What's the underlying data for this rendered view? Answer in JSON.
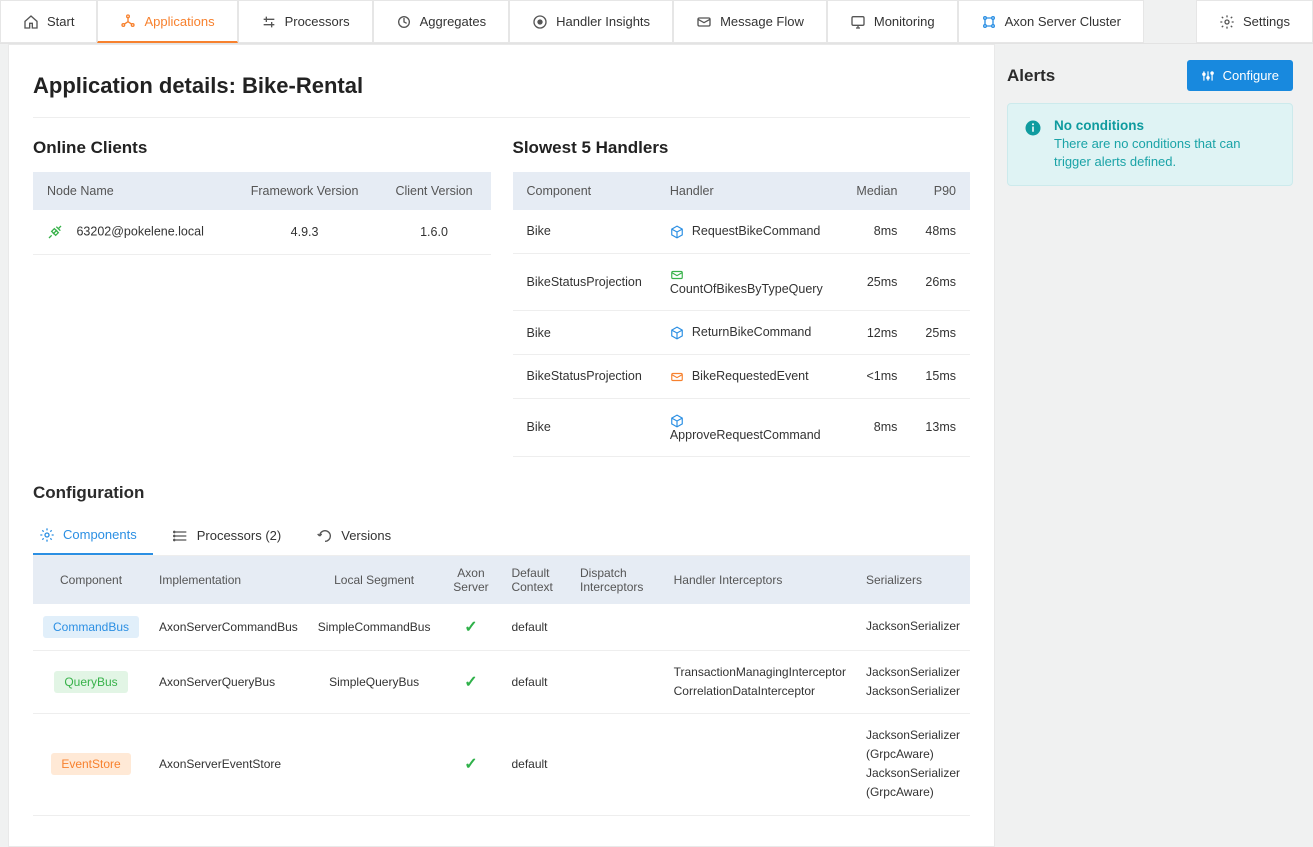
{
  "nav": {
    "start": "Start",
    "applications": "Applications",
    "processors": "Processors",
    "aggregates": "Aggregates",
    "handler_insights": "Handler Insights",
    "message_flow": "Message Flow",
    "monitoring": "Monitoring",
    "axon_server_cluster": "Axon Server Cluster",
    "settings": "Settings"
  },
  "page_title": "Application details: Bike-Rental",
  "online_clients": {
    "title": "Online Clients",
    "headers": {
      "node": "Node Name",
      "fw": "Framework Version",
      "client": "Client Version"
    },
    "rows": [
      {
        "node": "63202@pokelene.local",
        "fw": "4.9.3",
        "client": "1.6.0"
      }
    ]
  },
  "slowest": {
    "title": "Slowest 5 Handlers",
    "headers": {
      "component": "Component",
      "handler": "Handler",
      "median": "Median",
      "p90": "P90"
    },
    "rows": [
      {
        "component": "Bike",
        "icon": "cube-blue",
        "handler": "RequestBikeCommand",
        "median": "8ms",
        "p90": "48ms"
      },
      {
        "component": "BikeStatusProjection",
        "icon": "mail-green",
        "handler": "CountOfBikesByTypeQuery",
        "median": "25ms",
        "p90": "26ms"
      },
      {
        "component": "Bike",
        "icon": "cube-blue",
        "handler": "ReturnBikeCommand",
        "median": "12ms",
        "p90": "25ms"
      },
      {
        "component": "BikeStatusProjection",
        "icon": "mail-orange",
        "handler": "BikeRequestedEvent",
        "median": "<1ms",
        "p90": "15ms"
      },
      {
        "component": "Bike",
        "icon": "cube-blue",
        "handler": "ApproveRequestCommand",
        "median": "8ms",
        "p90": "13ms"
      }
    ]
  },
  "configuration": {
    "title": "Configuration",
    "tabs": {
      "components": "Components",
      "processors": "Processors (2)",
      "versions": "Versions"
    },
    "headers": {
      "component": "Component",
      "implementation": "Implementation",
      "local_segment": "Local Segment",
      "axon_server": "Axon Server",
      "default_context": "Default Context",
      "dispatch_interceptors": "Dispatch Interceptors",
      "handler_interceptors": "Handler Interceptors",
      "serializers": "Serializers"
    },
    "rows": [
      {
        "badge": "CommandBus",
        "badge_class": "cmd",
        "implementation": "AxonServerCommandBus",
        "local_segment": "SimpleCommandBus",
        "axon_server": "check",
        "default_context": "default",
        "dispatch_interceptors": "",
        "handler_interceptors": "",
        "serializers": "JacksonSerializer"
      },
      {
        "badge": "QueryBus",
        "badge_class": "qry",
        "implementation": "AxonServerQueryBus",
        "local_segment": "SimpleQueryBus",
        "axon_server": "check",
        "default_context": "default",
        "dispatch_interceptors": "",
        "handler_interceptors": "TransactionManagingInterceptor\nCorrelationDataInterceptor",
        "serializers": "JacksonSerializer\nJacksonSerializer"
      },
      {
        "badge": "EventStore",
        "badge_class": "evt",
        "implementation": "AxonServerEventStore",
        "local_segment": "",
        "axon_server": "check",
        "default_context": "default",
        "dispatch_interceptors": "",
        "handler_interceptors": "",
        "serializers": "JacksonSerializer (GrpcAware)\nJacksonSerializer (GrpcAware)"
      }
    ]
  },
  "alerts": {
    "title": "Alerts",
    "configure": "Configure",
    "box_title": "No conditions",
    "box_text": "There are no conditions that can trigger alerts defined."
  },
  "colors": {
    "accent_orange": "#f7812e",
    "accent_blue": "#2b8fe3",
    "accent_green": "#38b24a",
    "accent_teal": "#0f9b9f"
  }
}
